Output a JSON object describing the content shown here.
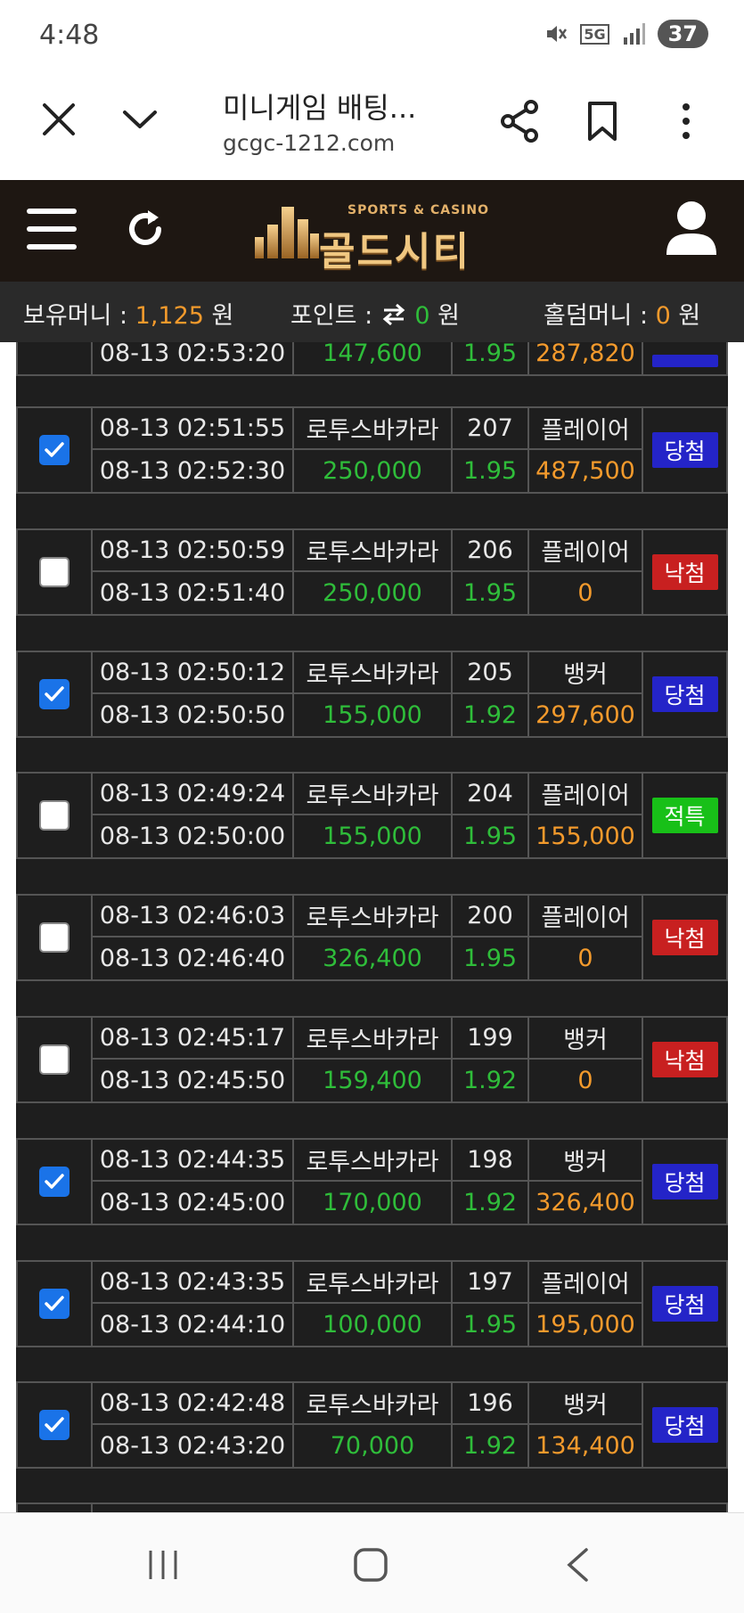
{
  "status_bar": {
    "time": "4:48",
    "network": "5G",
    "battery": "37"
  },
  "browser": {
    "title": "미니게임 배팅...",
    "url": "gcgc-1212.com"
  },
  "site": {
    "logo_tag": "SPORTS & CASINO",
    "logo_name": "골드시티"
  },
  "money": {
    "holding_label": "보유머니 :",
    "holding_value": "1,125",
    "holding_unit": "원",
    "point_label": "포인트 :",
    "point_value": "0",
    "point_unit": "원",
    "holdem_label": "홀덤머니 :",
    "holdem_value": "0",
    "holdem_unit": "원"
  },
  "partial_row": {
    "time": "08-13 02:53:20",
    "amount": "147,600",
    "odds": "1.95",
    "payout": "287,820"
  },
  "bets": [
    {
      "checked": true,
      "bet_time": "08-13 02:51:55",
      "result_time": "08-13 02:52:30",
      "game": "로투스바카라",
      "round": "207",
      "pick": "플레이어",
      "amount": "250,000",
      "odds": "1.95",
      "payout": "487,500",
      "status": "당첨",
      "status_type": "win"
    },
    {
      "checked": false,
      "bet_time": "08-13 02:50:59",
      "result_time": "08-13 02:51:40",
      "game": "로투스바카라",
      "round": "206",
      "pick": "플레이어",
      "amount": "250,000",
      "odds": "1.95",
      "payout": "0",
      "status": "낙첨",
      "status_type": "lose"
    },
    {
      "checked": true,
      "bet_time": "08-13 02:50:12",
      "result_time": "08-13 02:50:50",
      "game": "로투스바카라",
      "round": "205",
      "pick": "뱅커",
      "amount": "155,000",
      "odds": "1.92",
      "payout": "297,600",
      "status": "당첨",
      "status_type": "win"
    },
    {
      "checked": false,
      "bet_time": "08-13 02:49:24",
      "result_time": "08-13 02:50:00",
      "game": "로투스바카라",
      "round": "204",
      "pick": "플레이어",
      "amount": "155,000",
      "odds": "1.95",
      "payout": "155,000",
      "status": "적특",
      "status_type": "tie"
    },
    {
      "checked": false,
      "bet_time": "08-13 02:46:03",
      "result_time": "08-13 02:46:40",
      "game": "로투스바카라",
      "round": "200",
      "pick": "플레이어",
      "amount": "326,400",
      "odds": "1.95",
      "payout": "0",
      "status": "낙첨",
      "status_type": "lose"
    },
    {
      "checked": false,
      "bet_time": "08-13 02:45:17",
      "result_time": "08-13 02:45:50",
      "game": "로투스바카라",
      "round": "199",
      "pick": "뱅커",
      "amount": "159,400",
      "odds": "1.92",
      "payout": "0",
      "status": "낙첨",
      "status_type": "lose"
    },
    {
      "checked": true,
      "bet_time": "08-13 02:44:35",
      "result_time": "08-13 02:45:00",
      "game": "로투스바카라",
      "round": "198",
      "pick": "뱅커",
      "amount": "170,000",
      "odds": "1.92",
      "payout": "326,400",
      "status": "당첨",
      "status_type": "win"
    },
    {
      "checked": true,
      "bet_time": "08-13 02:43:35",
      "result_time": "08-13 02:44:10",
      "game": "로투스바카라",
      "round": "197",
      "pick": "플레이어",
      "amount": "100,000",
      "odds": "1.95",
      "payout": "195,000",
      "status": "당첨",
      "status_type": "win"
    },
    {
      "checked": true,
      "bet_time": "08-13 02:42:48",
      "result_time": "08-13 02:43:20",
      "game": "로투스바카라",
      "round": "196",
      "pick": "뱅커",
      "amount": "70,000",
      "odds": "1.92",
      "payout": "134,400",
      "status": "당첨",
      "status_type": "win"
    }
  ],
  "colors": {
    "win": "#2424c8",
    "lose": "#c82020",
    "tie": "#18c018",
    "amount": "#2fbd3a",
    "payout": "#f39a2c"
  }
}
